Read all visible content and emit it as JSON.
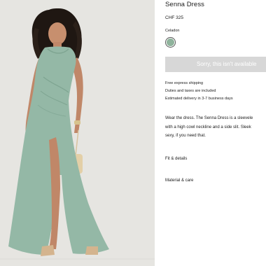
{
  "product": {
    "title": "Senna Dress",
    "price": "CHF 325",
    "color_label": "Celadon",
    "swatch_color": "#8fb39c",
    "soldout_label": "Sorry, this isn't available"
  },
  "shipping": {
    "line1": "Free express shipping",
    "line2": "Duties and taxes are included",
    "line3": "Estimated delivery in 3-7 business days"
  },
  "description": {
    "line1": "Wear the dress. The Senna Dress is a sleevele",
    "line2": "with a high cowl neckline and a side slit. Sleek",
    "line3": "sexy, if you need that."
  },
  "accordion": {
    "fit": "Fit & details",
    "material": "Material & care"
  },
  "image": {
    "background": "#e6e5e1",
    "dress_color": "#94b8a6"
  }
}
